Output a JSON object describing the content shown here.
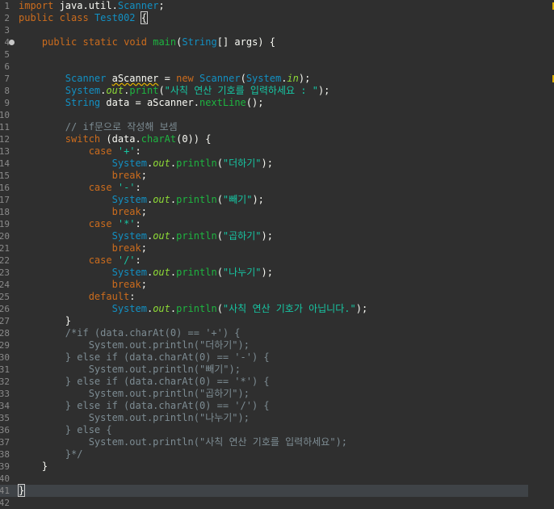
{
  "editor": {
    "lines": [
      {
        "n": "1",
        "t": "import java.util.Scanner;"
      },
      {
        "n": "2",
        "t": "public class Test002 {"
      },
      {
        "n": "3",
        "t": ""
      },
      {
        "n": "4",
        "t": "    public static void main(String[] args) {"
      },
      {
        "n": "5",
        "t": ""
      },
      {
        "n": "6",
        "t": ""
      },
      {
        "n": "7",
        "t": "        Scanner aScanner = new Scanner(System.in);"
      },
      {
        "n": "8",
        "t": "        System.out.print(\"사칙 연산 기호를 입력하세요 : \");"
      },
      {
        "n": "9",
        "t": "        String data = aScanner.nextLine();"
      },
      {
        "n": "10",
        "t": ""
      },
      {
        "n": "11",
        "t": "        // if문으로 작성해 보셈"
      },
      {
        "n": "12",
        "t": "        switch (data.charAt(0)) {"
      },
      {
        "n": "13",
        "t": "            case '+':"
      },
      {
        "n": "14",
        "t": "                System.out.println(\"더하기\");"
      },
      {
        "n": "15",
        "t": "                break;"
      },
      {
        "n": "16",
        "t": "            case '-':"
      },
      {
        "n": "17",
        "t": "                System.out.println(\"빼기\");"
      },
      {
        "n": "18",
        "t": "                break;"
      },
      {
        "n": "19",
        "t": "            case '*':"
      },
      {
        "n": "20",
        "t": "                System.out.println(\"곱하기\");"
      },
      {
        "n": "21",
        "t": "                break;"
      },
      {
        "n": "22",
        "t": "            case '/':"
      },
      {
        "n": "23",
        "t": "                System.out.println(\"나누기\");"
      },
      {
        "n": "24",
        "t": "                break;"
      },
      {
        "n": "25",
        "t": "            default:"
      },
      {
        "n": "26",
        "t": "                System.out.println(\"사칙 연산 기호가 아닙니다.\");"
      },
      {
        "n": "27",
        "t": "        }"
      },
      {
        "n": "28",
        "t": "        /*if (data.charAt(0) == '+') {"
      },
      {
        "n": "29",
        "t": "            System.out.println(\"더하기\");"
      },
      {
        "n": "30",
        "t": "        } else if (data.charAt(0) == '-') {"
      },
      {
        "n": "31",
        "t": "            System.out.println(\"빼기\");"
      },
      {
        "n": "32",
        "t": "        } else if (data.charAt(0) == '*') {"
      },
      {
        "n": "33",
        "t": "            System.out.println(\"곱하기\");"
      },
      {
        "n": "34",
        "t": "        } else if (data.charAt(0) == '/') {"
      },
      {
        "n": "35",
        "t": "            System.out.println(\"나누기\");"
      },
      {
        "n": "36",
        "t": "        } else {"
      },
      {
        "n": "37",
        "t": "            System.out.println(\"사칙 연산 기호를 입력하세요\");"
      },
      {
        "n": "38",
        "t": "        }*/"
      },
      {
        "n": "39",
        "t": "    }"
      },
      {
        "n": "40",
        "t": ""
      },
      {
        "n": "41",
        "t": "}"
      },
      {
        "n": "42",
        "t": ""
      }
    ]
  }
}
